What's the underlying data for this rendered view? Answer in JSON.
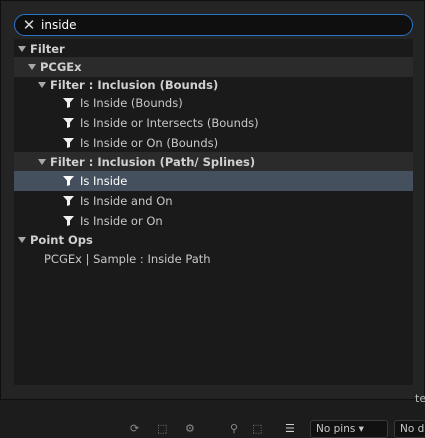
{
  "search": {
    "value": "inside",
    "clear_icon": "close-icon"
  },
  "tree": {
    "filter": "Filter",
    "pcgex": "PCGEx",
    "bounds_group": "Filter : Inclusion (Bounds)",
    "bounds_items": [
      "Is Inside (Bounds)",
      "Is Inside or Intersects (Bounds)",
      "Is Inside or On (Bounds)"
    ],
    "path_group": "Filter : Inclusion (Path/ Splines)",
    "path_items": [
      "Is Inside",
      "Is Inside and On",
      "Is Inside or On"
    ],
    "point_ops": "Point Ops",
    "point_ops_items": [
      "PCGEx | Sample : Inside Path"
    ]
  },
  "selected": "Is Inside",
  "bottom": {
    "pins_dropdown": "No pins",
    "second_dropdown": "No d",
    "edge_letter": "te"
  },
  "colors": {
    "accent": "#2a74c8",
    "selected_row": "#45505e"
  }
}
